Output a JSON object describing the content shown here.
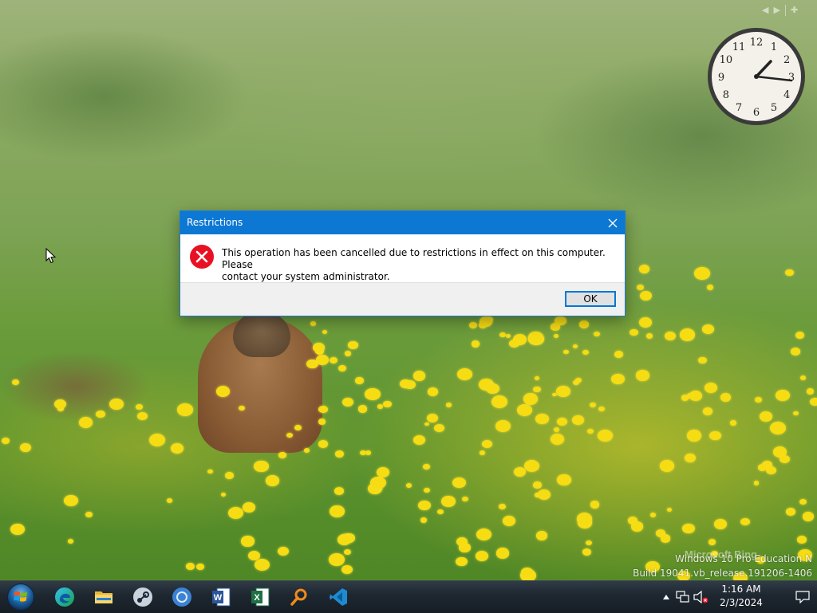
{
  "dialog": {
    "title": "Restrictions",
    "message": "This operation has been cancelled due to restrictions in effect on this computer. Please\ncontact your system administrator.",
    "ok_label": "OK",
    "icon": "error-icon"
  },
  "desktop": {
    "watermark_line1": "Windows 10 Pro Education N",
    "watermark_line2": "Build 19041.vb_release.191206-1406",
    "bing_mark": "Microsoft Bing",
    "clock_numbers": [
      "12",
      "1",
      "2",
      "3",
      "4",
      "5",
      "6",
      "7",
      "8",
      "9",
      "10",
      "11"
    ],
    "clock_time": "1:16"
  },
  "taskbar": {
    "start_icon": "windows-start-orb",
    "apps": [
      {
        "name": "edge",
        "icon": "edge-icon"
      },
      {
        "name": "file-explorer",
        "icon": "folder-icon"
      },
      {
        "name": "steam",
        "icon": "steam-icon"
      },
      {
        "name": "chrome",
        "icon": "chrome-icon"
      },
      {
        "name": "word",
        "icon": "word-icon",
        "letter": "W"
      },
      {
        "name": "excel",
        "icon": "excel-icon",
        "letter": "X"
      },
      {
        "name": "search",
        "icon": "magnifier-icon"
      },
      {
        "name": "vscode",
        "icon": "vscode-icon"
      }
    ],
    "tray": {
      "time": "1:16 AM",
      "date": "2/3/2024",
      "icons": [
        "show-hidden-icons-arrow",
        "network-icon",
        "volume-muted-icon",
        "action-center-icon"
      ]
    }
  },
  "colors": {
    "titlebar": "#0c78d4",
    "error_red": "#e81123",
    "taskbar": "#1e2730"
  }
}
